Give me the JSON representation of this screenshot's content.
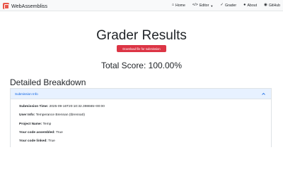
{
  "app": {
    "brand": "WebAssembliss",
    "brand_color": "#e8574b"
  },
  "nav": {
    "home": {
      "icon": "home-icon",
      "label": "Home"
    },
    "editor": {
      "icon": "code-icon",
      "label": "Editor"
    },
    "grader": {
      "icon": "grader-icon",
      "label": "Grader"
    },
    "about": {
      "icon": "info-icon",
      "label": "About"
    },
    "github": {
      "icon": "github-icon",
      "label": "GitHub"
    }
  },
  "page": {
    "title": "Grader Results",
    "download_label": "Download file for submission",
    "total_score": "Total Score: 100.00%",
    "breakdown_heading": "Detailed Breakdown"
  },
  "accordion": {
    "header": "Submission Info",
    "chevron_icon": "chevron-up-icon",
    "rows": [
      {
        "label": "Submission Time:",
        "value": "2025-09-16T20:10:32.398665+00:00"
      },
      {
        "label": "User Info:",
        "value": "Temperance Brennan (tbrenna0)"
      },
      {
        "label": "Project Name:",
        "value": "Temp"
      },
      {
        "label": "Your code assembled:",
        "value": "True"
      },
      {
        "label": "Your code linked:",
        "value": "True"
      }
    ]
  },
  "colors": {
    "accent": "#0c63e4",
    "danger": "#dc3545",
    "header_bg": "#e7f1ff"
  }
}
